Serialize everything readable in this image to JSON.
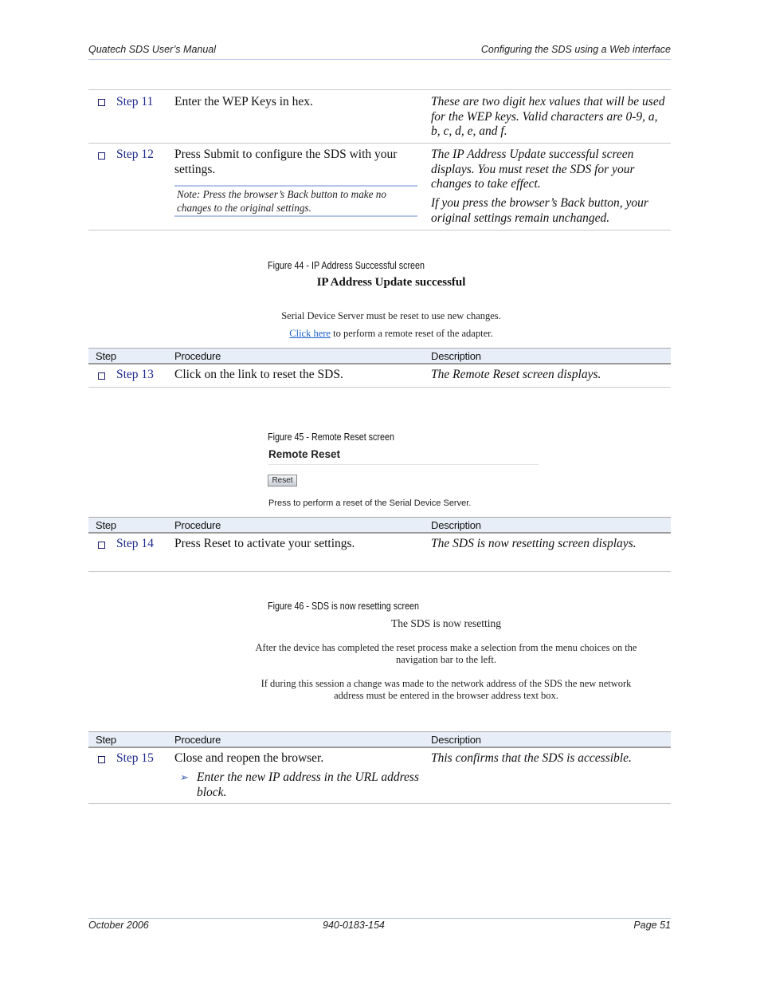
{
  "header": {
    "left": "Quatech SDS User’s Manual",
    "right": "Configuring the SDS using a Web interface"
  },
  "footer": {
    "left": "October 2006",
    "center": "940-0183-154",
    "right": "Page 51"
  },
  "table_headers": {
    "step": "Step",
    "procedure": "Procedure",
    "description": "Description"
  },
  "steps": {
    "s11": {
      "label": "Step 11",
      "procedure": "Enter the WEP Keys in hex.",
      "description": "These are two digit hex values that will be used for the WEP keys. Valid characters are 0-9, a, b, c, d, e, and f."
    },
    "s12": {
      "label": "Step 12",
      "procedure": "Press Submit to configure the SDS with your settings.",
      "note": "Note: Press the browser’s Back button to make no changes to the original settings.",
      "description_1": "The IP Address Update successful screen displays. You must reset the SDS for your changes to take effect.",
      "description_2": "If you press the browser’s Back button, your original settings remain unchanged."
    },
    "s13": {
      "label": "Step 13",
      "procedure": "Click on the link to reset the SDS.",
      "description": "The Remote Reset screen displays."
    },
    "s14": {
      "label": "Step 14",
      "procedure": "Press Reset to activate your settings.",
      "description": "The SDS is now resetting screen displays."
    },
    "s15": {
      "label": "Step 15",
      "procedure": "Close and reopen the browser.",
      "sub_item": "Enter the new IP address in the URL address block.",
      "description": "This confirms that the SDS is accessible."
    }
  },
  "figures": {
    "fig44": {
      "caption": "Figure 44 - IP Address Successful screen",
      "title": "IP Address Update successful",
      "line1": "Serial Device Server must be reset to use new changes.",
      "link": "Click here",
      "line2_rest": " to perform a remote reset of the adapter."
    },
    "fig45": {
      "caption": "Figure 45 - Remote Reset screen",
      "title": "Remote Reset",
      "button": "Reset",
      "text": "Press to perform a reset of the Serial Device Server."
    },
    "fig46": {
      "caption": "Figure 46 - SDS is now resetting screen",
      "title": "The SDS is now resetting",
      "p1": "After the device has completed the reset process make a selection from the menu choices on the navigation bar to the left.",
      "p2": "If during this session a change was made to the network address of the SDS the new network address must be entered in the browser address text box."
    }
  },
  "icons": {
    "checkbox": "checkbox-square",
    "arrow_bullet": "➢"
  },
  "colors": {
    "step_link": "#1f2a8c",
    "header_fill": "#e8eef8",
    "rule_blue": "#b3c6e7",
    "hyperlink": "#1a5fc8"
  }
}
